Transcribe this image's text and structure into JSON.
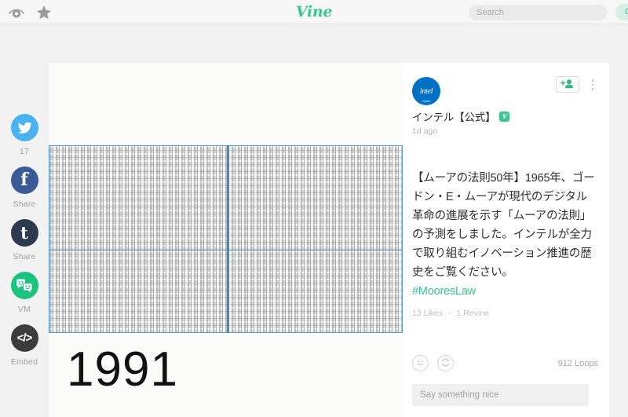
{
  "header": {
    "eye_icon": "eye-icon",
    "star_icon": "star-icon",
    "logo_text": "Vine",
    "search": {
      "value": "",
      "placeholder": "Search"
    },
    "get_vine_label": "Get Vine"
  },
  "share_rail": {
    "items": [
      {
        "network": "twitter",
        "glyph": "twitter-bird-icon",
        "label": "17"
      },
      {
        "network": "facebook",
        "glyph": "f",
        "label": "Share"
      },
      {
        "network": "tumblr",
        "glyph": "t",
        "label": "Share"
      },
      {
        "network": "vm",
        "glyph": "chat-bubbles-icon",
        "label": "VM"
      },
      {
        "network": "embed",
        "glyph": "</>",
        "label": "Embed"
      }
    ]
  },
  "video": {
    "year_label": "1991",
    "frame_description": "processor-die-transistor-grid"
  },
  "post": {
    "avatar_brand": "intel",
    "avatar_word": "intel",
    "avatar_sub": "Japan",
    "username": "インテル【公式】",
    "verified_glyph": "V",
    "timestamp": "1d ago",
    "follow_icon": "add-person-icon",
    "more_icon": "more-vertical-icon",
    "caption": "【ムーアの法則50年】1965年、ゴードン・E・ムーアが現代のデジタル革命の進展を示す「ムーアの法則」の予測をしました。インテルが全力で取り組むイノベーション推進の歴史をご覧ください。",
    "hashtag": "#MooresLaw",
    "likes": "13 Likes",
    "stats_separator": "·",
    "revines": "1 Revine",
    "like_icon": "smiley-face-icon",
    "revine_icon": "revine-loop-icon",
    "loops": "912 Loops",
    "comment": {
      "value": "",
      "placeholder": "Say something nice"
    }
  },
  "colors": {
    "vine_green": "#36c792",
    "intel_blue": "#0071c5",
    "twitter_blue": "#4ab3ef",
    "facebook_blue": "#3a5a98",
    "tumblr_navy": "#2c3a4d",
    "vm_green": "#19c57e",
    "embed_dark": "#3c3c3c",
    "grid_border_blue": "#5b9fd0"
  }
}
